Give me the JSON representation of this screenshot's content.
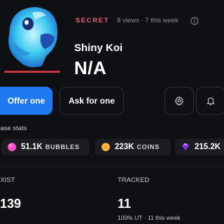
{
  "item": {
    "tier": "SECRET",
    "meta": "8 views · 7 this week",
    "name": "Shiny Koi",
    "value": "N/A"
  },
  "actions": {
    "offer_label": "Offer one",
    "ask_label": "Ask for one"
  },
  "base_stats": {
    "label": "Base stats",
    "bubbles": {
      "value": "51.1K",
      "unit": "BUBBLES",
      "icon": "pink-bubble-icon"
    },
    "coins": {
      "value": "223K",
      "unit": "COINS",
      "icon": "gold-coin-icon"
    },
    "gems": {
      "value": "215.2K",
      "icon": "purple-gem-icon"
    }
  },
  "exist": {
    "label": "EXIST",
    "value": "139"
  },
  "tracked": {
    "label": "TRACKED",
    "value": "11",
    "sub": "100% UT · 11 this week"
  },
  "colors": {
    "tier": "#ff5a77",
    "primary_button": "#1f78f0",
    "background": "#0f1014",
    "chip": "#1b1c22"
  }
}
